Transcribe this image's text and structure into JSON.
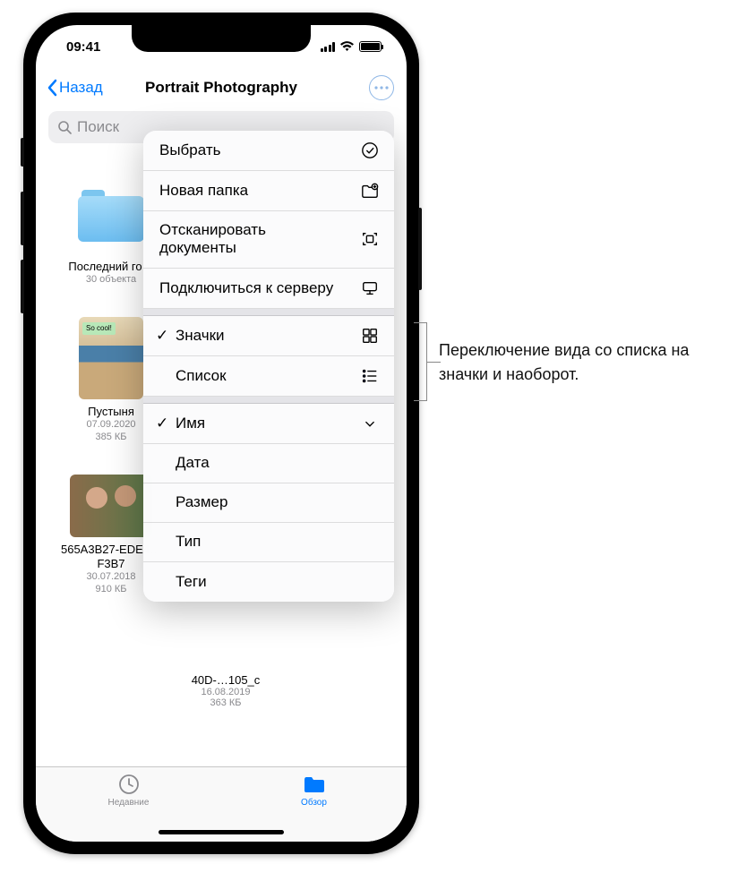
{
  "status": {
    "time": "09:41"
  },
  "nav": {
    "back": "Назад",
    "title": "Portrait Photography"
  },
  "search": {
    "placeholder": "Поиск"
  },
  "tiles": {
    "folder": {
      "name": "Последний го…",
      "sub": "30 объекта"
    },
    "p1": {
      "name": "Пустыня",
      "date": "07.09.2020",
      "size": "385 КБ"
    },
    "p2": {
      "name": "565A3B27-EDE4…F3B7",
      "date": "30.07.2018",
      "size": "910 КБ"
    },
    "p3": {
      "name": "40D-…105_c",
      "date": "16.08.2019",
      "size": "363 КБ"
    }
  },
  "menu": {
    "select": "Выбрать",
    "new_folder": "Новая папка",
    "scan": "Отсканировать документы",
    "connect": "Подключиться к серверу",
    "icons": "Значки",
    "list": "Список",
    "name": "Имя",
    "date": "Дата",
    "size_m": "Размер",
    "type": "Тип",
    "tags": "Теги"
  },
  "tabs": {
    "recents": "Недавние",
    "browse": "Обзор"
  },
  "callout": "Переключение вида со списка на значки и наоборот."
}
